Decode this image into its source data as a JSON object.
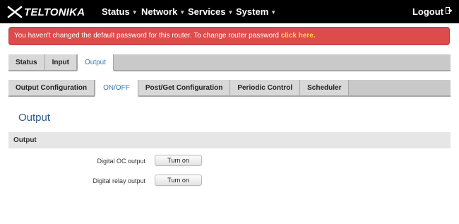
{
  "brand": {
    "name": "TELTONIKA"
  },
  "nav": {
    "items": [
      {
        "label": "Status"
      },
      {
        "label": "Network"
      },
      {
        "label": "Services"
      },
      {
        "label": "System"
      }
    ],
    "logout_label": "Logout"
  },
  "alert": {
    "text": "You haven't changed the default password for this router. To change router password ",
    "link_text": "click here."
  },
  "tabs": [
    {
      "label": "Status"
    },
    {
      "label": "Input"
    },
    {
      "label": "Output",
      "active": true
    }
  ],
  "subtabs": [
    {
      "label": "Output Configuration"
    },
    {
      "label": "ON/OFF",
      "active": true
    },
    {
      "label": "Post/Get Configuration"
    },
    {
      "label": "Periodic Control"
    },
    {
      "label": "Scheduler"
    }
  ],
  "page": {
    "heading": "Output",
    "section_title": "Output",
    "rows": [
      {
        "label": "Digital OC output",
        "button": "Turn on"
      },
      {
        "label": "Digital relay output",
        "button": "Turn on"
      }
    ]
  },
  "colors": {
    "alert_bg": "#dd4b4b",
    "link": "#ffd94a",
    "accent": "#3a7ab8",
    "heading": "#2c5a8e"
  }
}
